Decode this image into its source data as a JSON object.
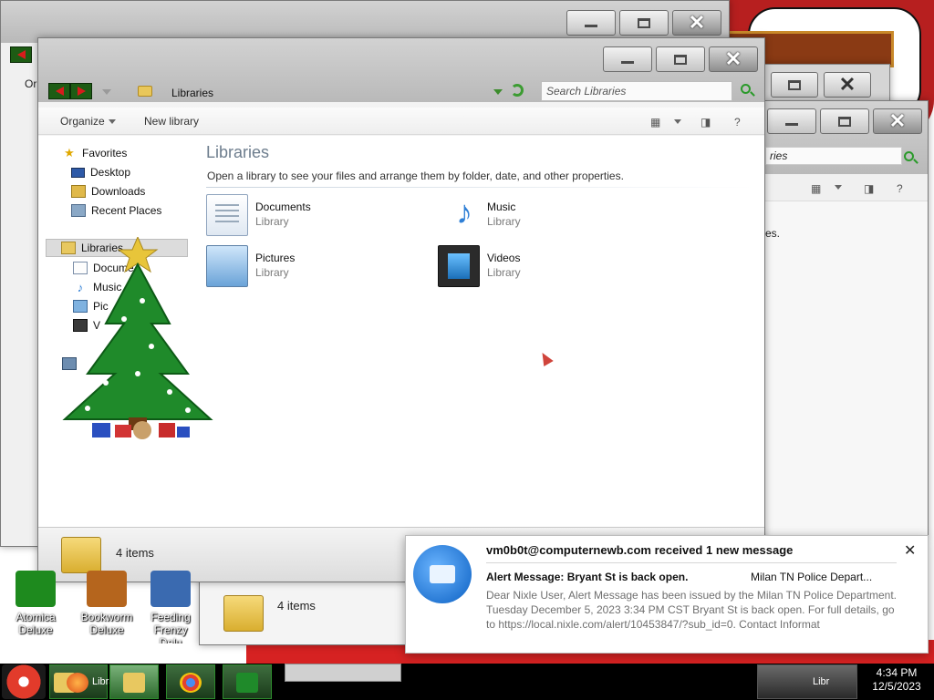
{
  "main_window": {
    "title_crumb": "Libraries",
    "search": {
      "placeholder": "Search Libraries"
    },
    "toolbar": {
      "organize": "Organize",
      "new_library": "New library",
      "help": "?"
    },
    "nav": {
      "favorites": {
        "label": "Favorites",
        "items": [
          "Desktop",
          "Downloads",
          "Recent Places"
        ]
      },
      "libraries": {
        "label": "Libraries",
        "items": [
          "Docume",
          "Music",
          "Pic",
          "V"
        ]
      }
    },
    "content": {
      "heading": "Libraries",
      "subheading": "Open a library to see your files and arrange them by folder, date, and other properties.",
      "items": [
        {
          "name": "Documents",
          "type": "Library",
          "icon": "documents-library-icon"
        },
        {
          "name": "Music",
          "type": "Library",
          "icon": "music-library-icon"
        },
        {
          "name": "Pictures",
          "type": "Library",
          "icon": "pictures-library-icon"
        },
        {
          "name": "Videos",
          "type": "Library",
          "icon": "videos-library-icon"
        }
      ]
    },
    "status": "4 items"
  },
  "back_windows": {
    "left_partial": "Or",
    "right_search_partial": "ries",
    "right_text_partial": "es.",
    "bottom_status": "4 items"
  },
  "desktop_icons": [
    {
      "label": "Atomica Deluxe",
      "color": "#1e8a1e"
    },
    {
      "label": "Bookworm Deluxe",
      "color": "#b5651d"
    },
    {
      "label": "Feeding Frenzy Delu",
      "color": "#3a6ab0"
    }
  ],
  "notification": {
    "header": "vm0b0t@computernewb.com received 1 new message",
    "subject": "Alert Message: Bryant St is back open.",
    "sender": "Milan TN Police Depart...",
    "body": "Dear Nixle User, Alert Message has been issued by the Milan TN Police Department. Tuesday December 5, 2023 3:34 PM CST Bryant St is back open. For full details, go to https://local.nixle.com/alert/10453847/?sub_id=0. Contact Informat",
    "close": "✕"
  },
  "taskbar": {
    "task_label": "Libra",
    "tray_label": "Libr",
    "time": "4:34 PM",
    "date": "12/5/2023"
  }
}
